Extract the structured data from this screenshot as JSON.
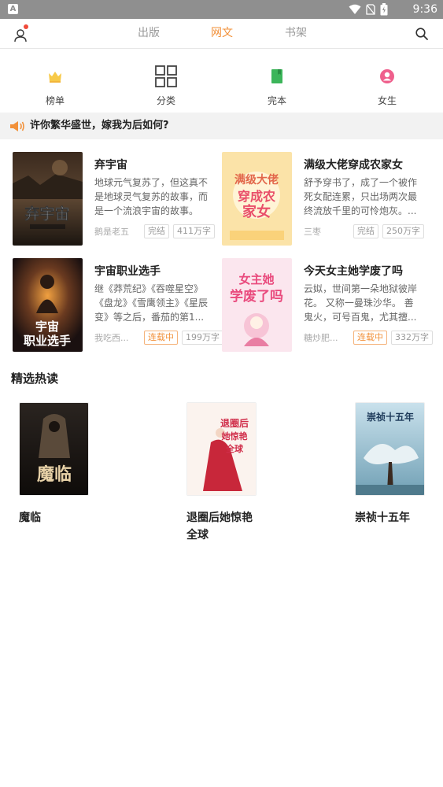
{
  "statusbar": {
    "time": "9:36"
  },
  "nav": {
    "tabs": [
      {
        "label": "出版"
      },
      {
        "label": "网文"
      },
      {
        "label": "书架"
      }
    ],
    "active_tab": "网文"
  },
  "categories": [
    {
      "label": "榜单",
      "icon": "crown-icon"
    },
    {
      "label": "分类",
      "icon": "grid-icon"
    },
    {
      "label": "完本",
      "icon": "book-icon"
    },
    {
      "label": "女生",
      "icon": "female-icon"
    }
  ],
  "notice": {
    "text": "许你繁华盛世，嫁我为后如何?"
  },
  "books": [
    {
      "title": "弃宇宙",
      "desc": "地球元气复苏了，但这真不是地球灵气复苏的故事，而是一个流浪宇宙的故事。",
      "author": "鹅是老五",
      "status": "完结",
      "words": "411万字",
      "cover_text": "弃宇宙"
    },
    {
      "title": "满级大佬穿成农家女",
      "desc": "舒予穿书了，成了一个被作死女配连累，只出场两次最终流放千里的可怜炮灰。...",
      "author": "三枣",
      "status": "完结",
      "words": "250万字",
      "cover_text": "满级大佬穿成农家女"
    },
    {
      "title": "宇宙职业选手",
      "desc": "继《莽荒纪》《吞噬星空》《盘龙》《雪鹰领主》《星辰变》等之后，番茄的第1...",
      "author": "我吃西...",
      "status": "连载中",
      "words": "199万字",
      "cover_text": "宇宙职业选手"
    },
    {
      "title": "今天女主她学废了吗",
      "desc": "云姒，世间第一朵地狱彼岸花。 又称一曼珠沙华。 善鬼火，可号百鬼，尤其擅...",
      "author": "糖炒肥...",
      "status": "连载中",
      "words": "332万字",
      "cover_text": "今天女主她学废了吗"
    }
  ],
  "hot": {
    "title": "精选热读",
    "items": [
      {
        "title": "魔临",
        "cover_text": "魔临"
      },
      {
        "title": "退圈后她惊艳全球",
        "cover_text": "退圈后她惊艳全球"
      },
      {
        "title": "崇祯十五年",
        "cover_text": "崇祯十五年"
      }
    ]
  },
  "colors": {
    "accent": "#f2913a",
    "notice_bg": "#f2f2f2",
    "status_bar": "#8f8f8f"
  }
}
